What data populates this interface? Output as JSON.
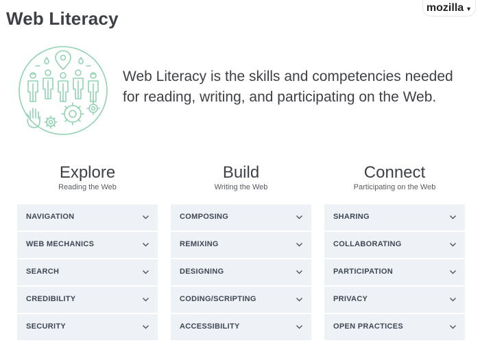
{
  "header": {
    "title": "Web Literacy",
    "brand_label": "mozilla",
    "brand_icon": "chevron-down-icon"
  },
  "hero": {
    "illustration_icon": "people-community-icon",
    "description": "Web Literacy is the skills and competencies needed for reading, writing, and participating on the Web."
  },
  "columns": [
    {
      "title": "Explore",
      "subtitle": "Reading the Web",
      "items": [
        {
          "label": "NAVIGATION"
        },
        {
          "label": "WEB MECHANICS"
        },
        {
          "label": "SEARCH"
        },
        {
          "label": "CREDIBILITY"
        },
        {
          "label": "SECURITY"
        }
      ]
    },
    {
      "title": "Build",
      "subtitle": "Writing the Web",
      "items": [
        {
          "label": "COMPOSING"
        },
        {
          "label": "REMIXING"
        },
        {
          "label": "DESIGNING"
        },
        {
          "label": "CODING/SCRIPTING"
        },
        {
          "label": "ACCESSIBILITY"
        }
      ]
    },
    {
      "title": "Connect",
      "subtitle": "Participating on the Web",
      "items": [
        {
          "label": "SHARING"
        },
        {
          "label": "COLLABORATING"
        },
        {
          "label": "PARTICIPATION"
        },
        {
          "label": "PRIVACY"
        },
        {
          "label": "OPEN PRACTICES"
        }
      ]
    }
  ],
  "colors": {
    "accent_green": "#8fd3b0",
    "item_background": "#eef1f5",
    "text_dark": "#3d4147"
  }
}
